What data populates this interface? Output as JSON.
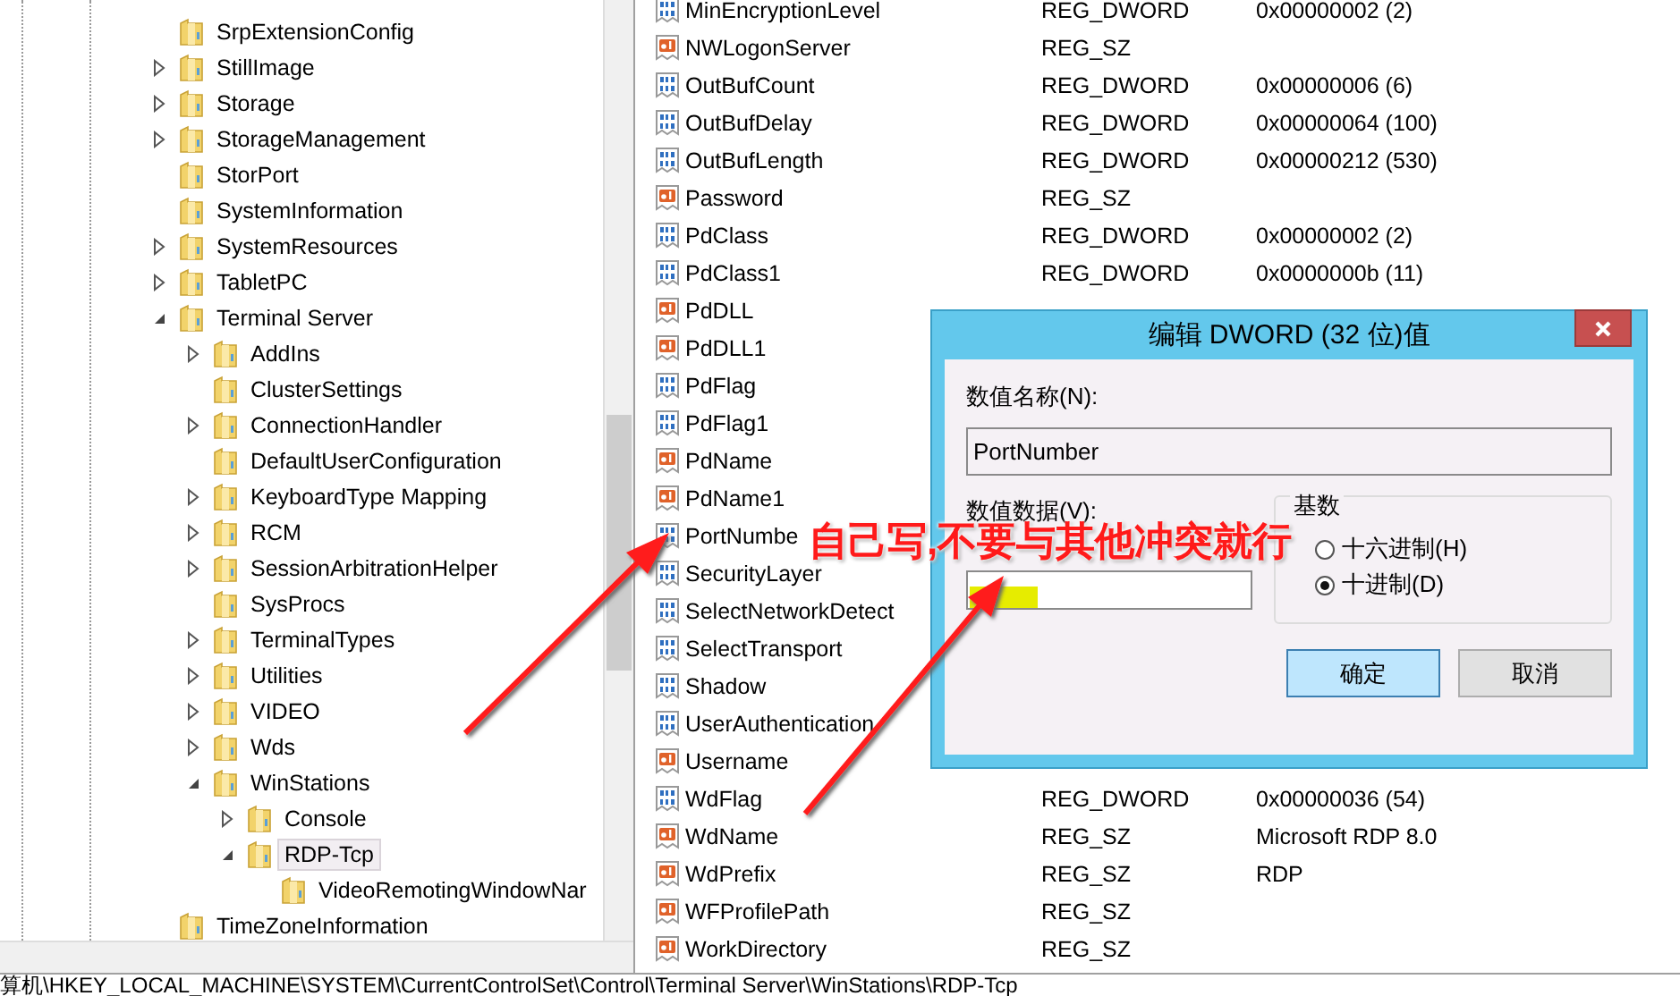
{
  "tree": {
    "items": [
      {
        "label": "SrpExtensionConfig",
        "kind": "leaf",
        "selected": false
      },
      {
        "label": "StillImage",
        "kind": "branch",
        "expanded": false,
        "selected": false
      },
      {
        "label": "Storage",
        "kind": "branch",
        "expanded": false,
        "selected": false
      },
      {
        "label": "StorageManagement",
        "kind": "branch",
        "expanded": false,
        "selected": false
      },
      {
        "label": "StorPort",
        "kind": "leaf",
        "selected": false
      },
      {
        "label": "SystemInformation",
        "kind": "leaf",
        "selected": false
      },
      {
        "label": "SystemResources",
        "kind": "branch",
        "expanded": false,
        "selected": false
      },
      {
        "label": "TabletPC",
        "kind": "branch",
        "expanded": false,
        "selected": false
      },
      {
        "label": "Terminal Server",
        "kind": "branch",
        "expanded": true,
        "selected": false,
        "children": [
          {
            "label": "AddIns",
            "kind": "branch",
            "expanded": false,
            "selected": false
          },
          {
            "label": "ClusterSettings",
            "kind": "leaf",
            "selected": false
          },
          {
            "label": "ConnectionHandler",
            "kind": "branch",
            "expanded": false,
            "selected": false
          },
          {
            "label": "DefaultUserConfiguration",
            "kind": "leaf",
            "selected": false
          },
          {
            "label": "KeyboardType Mapping",
            "kind": "branch",
            "expanded": false,
            "selected": false
          },
          {
            "label": "RCM",
            "kind": "branch",
            "expanded": false,
            "selected": false
          },
          {
            "label": "SessionArbitrationHelper",
            "kind": "branch",
            "expanded": false,
            "selected": false
          },
          {
            "label": "SysProcs",
            "kind": "leaf",
            "selected": false
          },
          {
            "label": "TerminalTypes",
            "kind": "branch",
            "expanded": false,
            "selected": false
          },
          {
            "label": "Utilities",
            "kind": "branch",
            "expanded": false,
            "selected": false
          },
          {
            "label": "VIDEO",
            "kind": "branch",
            "expanded": false,
            "selected": false
          },
          {
            "label": "Wds",
            "kind": "branch",
            "expanded": false,
            "selected": false
          },
          {
            "label": "WinStations",
            "kind": "branch",
            "expanded": true,
            "selected": false,
            "children": [
              {
                "label": "Console",
                "kind": "branch",
                "expanded": false,
                "selected": false
              },
              {
                "label": "RDP-Tcp",
                "kind": "branch",
                "expanded": true,
                "selected": true,
                "children": [
                  {
                    "label": "VideoRemotingWindowNar",
                    "kind": "leaf",
                    "selected": false
                  }
                ]
              }
            ]
          }
        ]
      },
      {
        "label": "TimeZoneInformation",
        "kind": "leaf",
        "selected": false
      }
    ]
  },
  "values": [
    {
      "name": "MinEncryptionLevel",
      "kind": "dword",
      "type": "REG_DWORD",
      "data": "0x00000002 (2)"
    },
    {
      "name": "NWLogonServer",
      "kind": "string",
      "type": "REG_SZ"
    },
    {
      "name": "OutBufCount",
      "kind": "dword",
      "type": "REG_DWORD",
      "data": "0x00000006 (6)"
    },
    {
      "name": "OutBufDelay",
      "kind": "dword",
      "type": "REG_DWORD",
      "data": "0x00000064 (100)"
    },
    {
      "name": "OutBufLength",
      "kind": "dword",
      "type": "REG_DWORD",
      "data": "0x00000212 (530)"
    },
    {
      "name": "Password",
      "kind": "string",
      "type": "REG_SZ"
    },
    {
      "name": "PdClass",
      "kind": "dword",
      "type": "REG_DWORD",
      "data": "0x00000002 (2)"
    },
    {
      "name": "PdClass1",
      "kind": "dword",
      "type": "REG_DWORD",
      "data": "0x0000000b (11)"
    },
    {
      "name": "PdDLL",
      "kind": "string"
    },
    {
      "name": "PdDLL1",
      "kind": "string"
    },
    {
      "name": "PdFlag",
      "kind": "dword"
    },
    {
      "name": "PdFlag1",
      "kind": "dword"
    },
    {
      "name": "PdName",
      "kind": "string"
    },
    {
      "name": "PdName1",
      "kind": "string"
    },
    {
      "name": "PortNumbe",
      "kind": "dword"
    },
    {
      "name": "SecurityLayer",
      "kind": "dword"
    },
    {
      "name": "SelectNetworkDetect",
      "kind": "dword"
    },
    {
      "name": "SelectTransport",
      "kind": "dword"
    },
    {
      "name": "Shadow",
      "kind": "dword"
    },
    {
      "name": "UserAuthentication",
      "kind": "dword"
    },
    {
      "name": "Username",
      "kind": "string"
    },
    {
      "name": "WdFlag",
      "kind": "dword",
      "type": "REG_DWORD",
      "data": "0x00000036 (54)"
    },
    {
      "name": "WdName",
      "kind": "string",
      "type": "REG_SZ",
      "data": "Microsoft RDP 8.0"
    },
    {
      "name": "WdPrefix",
      "kind": "string",
      "type": "REG_SZ",
      "data": "RDP"
    },
    {
      "name": "WFProfilePath",
      "kind": "string",
      "type": "REG_SZ"
    },
    {
      "name": "WorkDirectory",
      "kind": "string",
      "type": "REG_SZ"
    }
  ],
  "status_bar": "算机\\HKEY_LOCAL_MACHINE\\SYSTEM\\CurrentControlSet\\Control\\Terminal Server\\WinStations\\RDP-Tcp",
  "dialog": {
    "title": "编辑 DWORD (32 位)值",
    "name_label": "数值名称(N):",
    "name_value": "PortNumber",
    "data_label": "数值数据(V):",
    "base": {
      "legend": "基数",
      "options": [
        {
          "label": "十六进制(H)",
          "selected": false
        },
        {
          "label": "十进制(D)",
          "selected": true
        }
      ]
    },
    "buttons": [
      {
        "label": "确定",
        "default": true
      },
      {
        "label": "取消",
        "default": false
      }
    ]
  },
  "annotation": "自己写,不要与其他冲突就行"
}
